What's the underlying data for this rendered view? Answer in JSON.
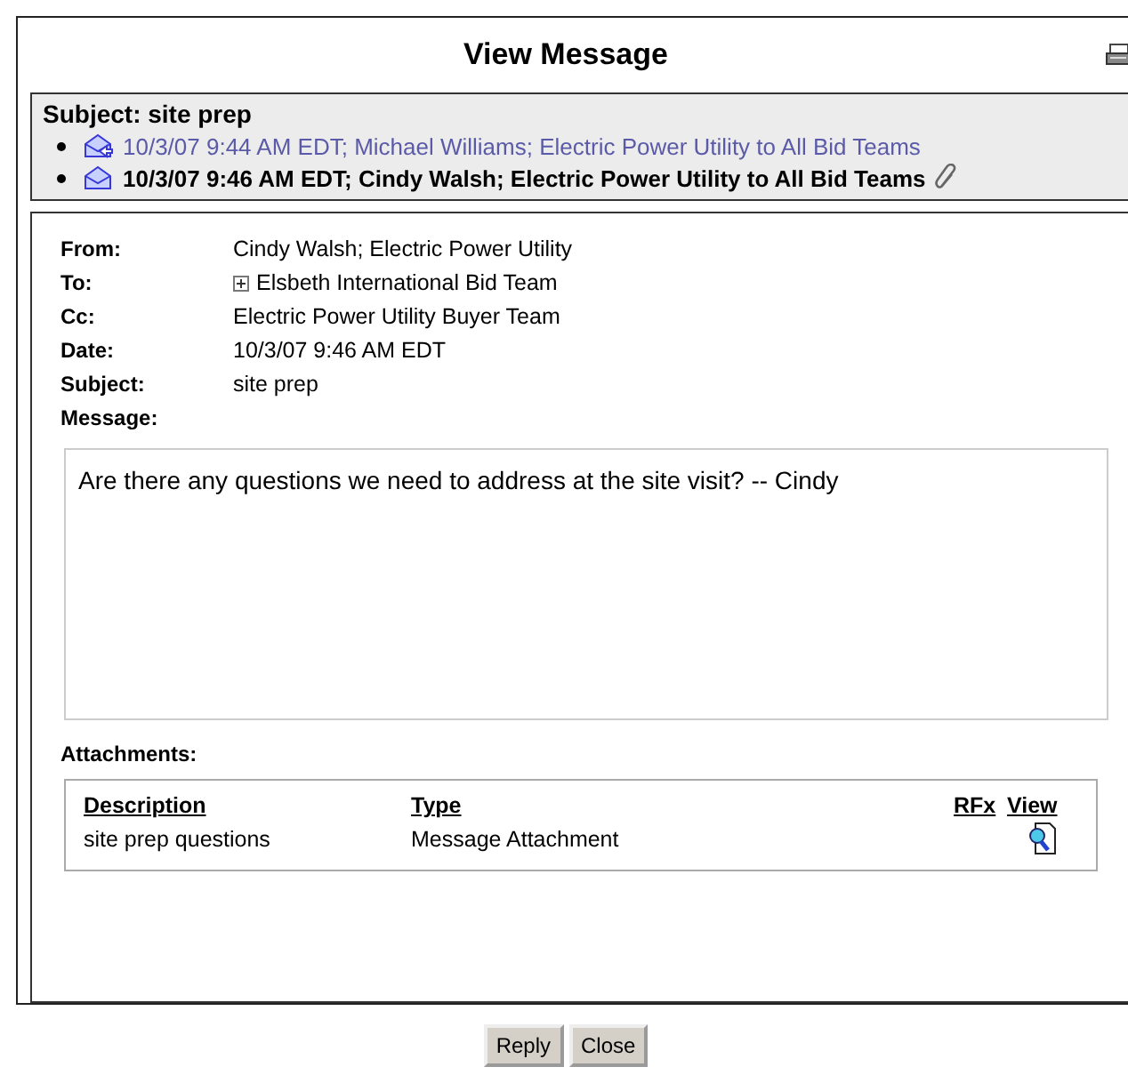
{
  "window": {
    "title": "View Message"
  },
  "thread": {
    "subject": "Subject: site prep",
    "messages": [
      {
        "text": "10/3/07 9:44 AM EDT; Michael Williams; Electric Power Utility to All Bid Teams",
        "selected": false,
        "replied": true,
        "has_attachment": false
      },
      {
        "text": "10/3/07 9:46 AM EDT; Cindy Walsh; Electric Power Utility to All Bid Teams",
        "selected": true,
        "replied": false,
        "has_attachment": true
      }
    ]
  },
  "fields": [
    {
      "label": "From:",
      "value": "Cindy Walsh; Electric Power Utility",
      "expandable": false
    },
    {
      "label": "To:",
      "value": "Elsbeth International Bid Team",
      "expandable": true
    },
    {
      "label": "Cc:",
      "value": "Electric Power Utility Buyer Team",
      "expandable": false
    },
    {
      "label": "Date:",
      "value": "10/3/07 9:46 AM EDT",
      "expandable": false
    },
    {
      "label": "Subject:",
      "value": "site prep",
      "expandable": false
    }
  ],
  "message": {
    "label": "Message:",
    "body": "Are there any questions we need to address at the site visit? -- Cindy"
  },
  "attachments": {
    "label": "Attachments:",
    "columns": [
      "Description",
      "Type",
      "RFx",
      "View"
    ],
    "rows": [
      {
        "description": "site prep questions",
        "type": "Message Attachment",
        "rfx": ""
      }
    ]
  },
  "buttons": [
    "Reply",
    "Close"
  ]
}
